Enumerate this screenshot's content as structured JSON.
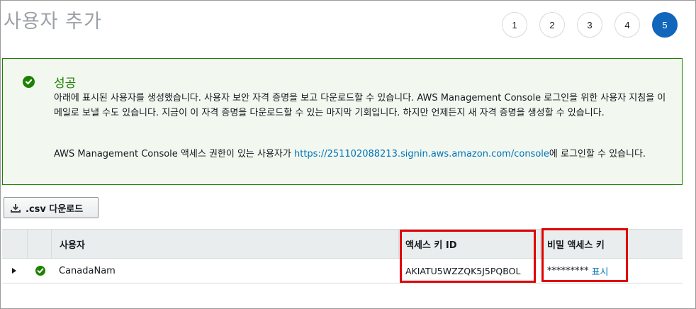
{
  "page": {
    "title": "사용자 추가"
  },
  "steps": [
    {
      "label": "1",
      "active": false
    },
    {
      "label": "2",
      "active": false
    },
    {
      "label": "3",
      "active": false
    },
    {
      "label": "4",
      "active": false
    },
    {
      "label": "5",
      "active": true
    }
  ],
  "alert": {
    "type": "success",
    "icon": "check-circle-icon",
    "title": "성공",
    "body": "아래에 표시된 사용자를 생성했습니다. 사용자 보안 자격 증명을 보고 다운로드할 수 있습니다. AWS Management Console 로그인을 위한 사용자 지침을 이메일로 보낼 수도 있습니다. 지금이 이 자격 증명을 다운로드할 수 있는 마지막 기회입니다. 하지만 언제든지 새 자격 증명을 생성할 수 있습니다.",
    "console_prefix": "AWS Management Console 액세스 권한이 있는 사용자가 ",
    "console_link": "https://251102088213.signin.aws.amazon.com/console",
    "console_suffix": "에 로그인할 수 있습니다."
  },
  "download_button": {
    "icon": "download-icon",
    "label": ".csv 다운로드"
  },
  "table": {
    "headers": {
      "user": "사용자",
      "access_key_id": "액세스 키 ID",
      "secret_access_key": "비밀 액세스 키"
    },
    "rows": [
      {
        "expand_icon": "triangle-right-icon",
        "status_icon": "check-circle-icon",
        "user": "CanadaNam",
        "access_key_id": "AKIATU5WZZQK5J5PQBOL",
        "secret_masked": "*********",
        "show_label": "표시"
      }
    ]
  },
  "colors": {
    "success": "#1d8102",
    "primary": "#1166bb",
    "link": "#0073bb",
    "highlight": "#e00000"
  }
}
